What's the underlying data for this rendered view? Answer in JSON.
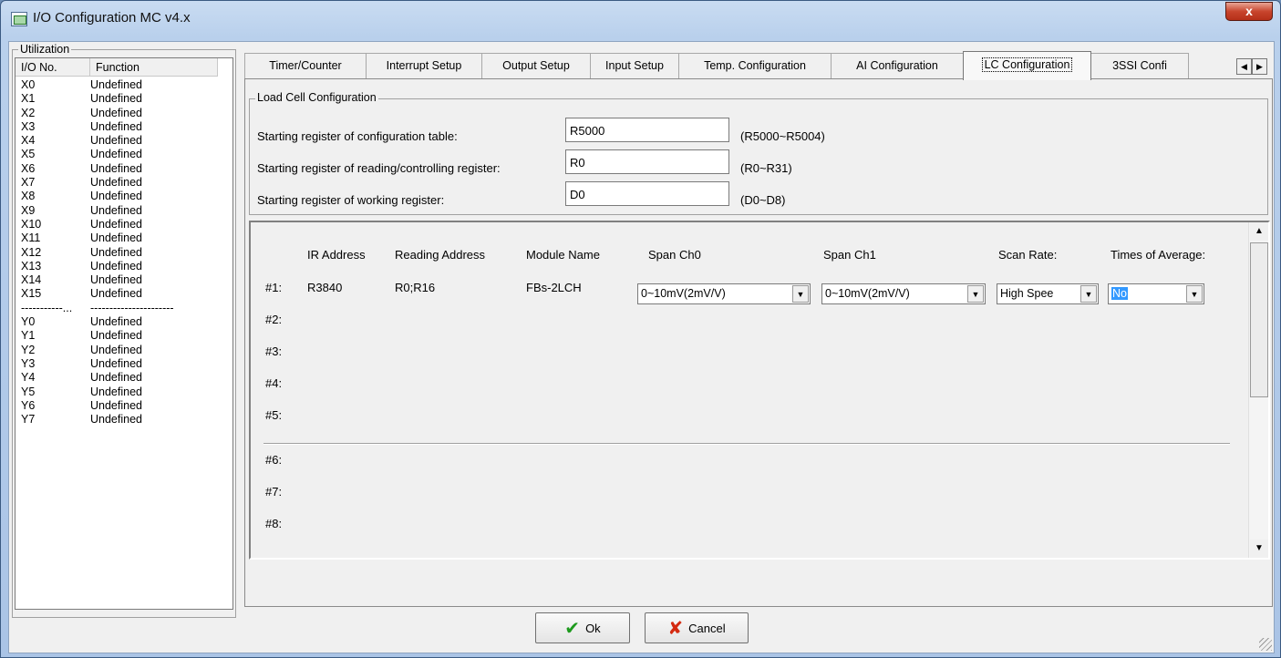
{
  "window": {
    "title": "I/O Configuration MC v4.x",
    "close_glyph": "x"
  },
  "utilization": {
    "legend": "Utilization",
    "columns": [
      "I/O No.",
      "Function"
    ],
    "rows": [
      [
        "X0",
        "Undefined"
      ],
      [
        "X1",
        "Undefined"
      ],
      [
        "X2",
        "Undefined"
      ],
      [
        "X3",
        "Undefined"
      ],
      [
        "X4",
        "Undefined"
      ],
      [
        "X5",
        "Undefined"
      ],
      [
        "X6",
        "Undefined"
      ],
      [
        "X7",
        "Undefined"
      ],
      [
        "X8",
        "Undefined"
      ],
      [
        "X9",
        "Undefined"
      ],
      [
        "X10",
        "Undefined"
      ],
      [
        "X11",
        "Undefined"
      ],
      [
        "X12",
        "Undefined"
      ],
      [
        "X13",
        "Undefined"
      ],
      [
        "X14",
        "Undefined"
      ],
      [
        "X15",
        "Undefined"
      ],
      [
        "-----------...",
        "----------------------"
      ],
      [
        "Y0",
        "Undefined"
      ],
      [
        "Y1",
        "Undefined"
      ],
      [
        "Y2",
        "Undefined"
      ],
      [
        "Y3",
        "Undefined"
      ],
      [
        "Y4",
        "Undefined"
      ],
      [
        "Y5",
        "Undefined"
      ],
      [
        "Y6",
        "Undefined"
      ],
      [
        "Y7",
        "Undefined"
      ]
    ]
  },
  "tabs": [
    {
      "label": "Timer/Counter",
      "width": 0
    },
    {
      "label": "Interrupt Setup"
    },
    {
      "label": "Output Setup"
    },
    {
      "label": "Input Setup"
    },
    {
      "label": "Temp. Configuration"
    },
    {
      "label": "AI Configuration"
    },
    {
      "label": "LC Configuration",
      "active": true
    },
    {
      "label": "3SSI Confi"
    }
  ],
  "tab_scroll": {
    "left": "◀",
    "right": "▶"
  },
  "lc": {
    "legend": "Load Cell Configuration",
    "fields": [
      {
        "label": "Starting register of configuration table:",
        "value": "R5000",
        "range": "(R5000~R5004)"
      },
      {
        "label": "Starting register of reading/controlling register:",
        "value": "R0",
        "range": "(R0~R31)"
      },
      {
        "label": "Starting register of  working register:",
        "value": "D0",
        "range": "(D0~D8)"
      }
    ]
  },
  "modules": {
    "headers": {
      "ir": "IR Address",
      "reading": "Reading Address",
      "name": "Module Name",
      "span0": "Span Ch0",
      "span1": "Span Ch1",
      "scan": "Scan Rate:",
      "avg": "Times of Average:"
    },
    "row_labels": [
      "#1:",
      "#2:",
      "#3:",
      "#4:",
      "#5:",
      "#6:",
      "#7:",
      "#8:"
    ],
    "row1": {
      "ir": "R3840",
      "reading": "R0;R16",
      "name": "FBs-2LCH",
      "span0": "0~10mV(2mV/V)",
      "span1": "0~10mV(2mV/V)",
      "scan": "High Spee",
      "avg": "No"
    }
  },
  "buttons": {
    "ok": "Ok",
    "cancel": "Cancel",
    "ok_glyph": "✔",
    "cancel_glyph": "✘"
  },
  "colors": {
    "ok_check": "#1e9a1e",
    "cancel_x": "#d42a10",
    "selection": "#3399ff"
  }
}
